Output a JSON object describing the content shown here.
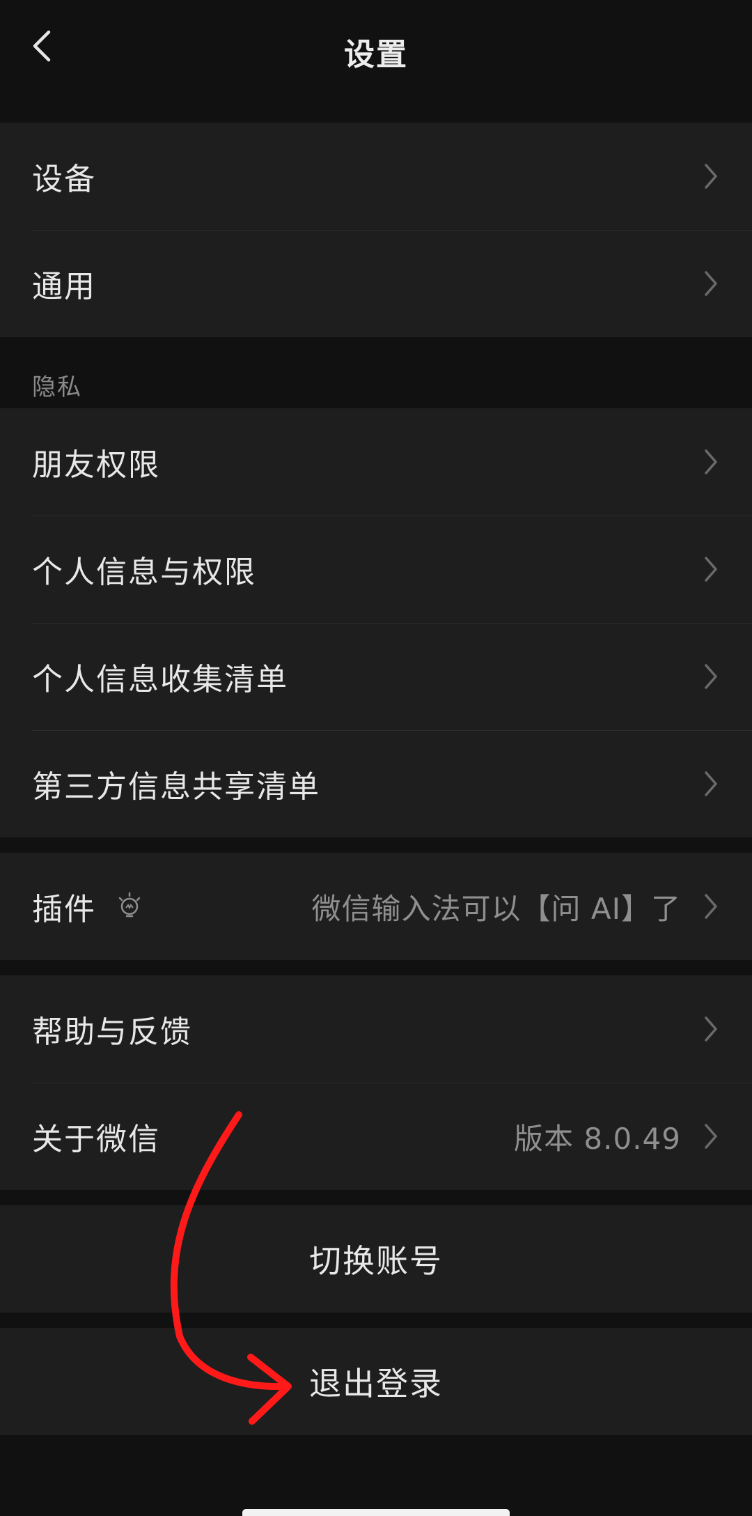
{
  "header": {
    "title": "设置",
    "back_icon": "chevron-left-icon"
  },
  "group_general": {
    "items": [
      {
        "label": "设备"
      },
      {
        "label": "通用"
      }
    ]
  },
  "privacy": {
    "section_label": "隐私",
    "items": [
      {
        "label": "朋友权限"
      },
      {
        "label": "个人信息与权限"
      },
      {
        "label": "个人信息收集清单"
      },
      {
        "label": "第三方信息共享清单"
      }
    ]
  },
  "plugins": {
    "label": "插件",
    "icon": "lightbulb-icon",
    "value": "微信输入法可以【问 AI】了"
  },
  "help": {
    "items": [
      {
        "label": "帮助与反馈",
        "value": ""
      },
      {
        "label": "关于微信",
        "value": "版本 8.0.49"
      }
    ]
  },
  "account": {
    "switch_label": "切换账号",
    "logout_label": "退出登录"
  },
  "colors": {
    "background": "#111111",
    "row_background": "#1e1e1e",
    "annotation": "#ff1a1a"
  }
}
